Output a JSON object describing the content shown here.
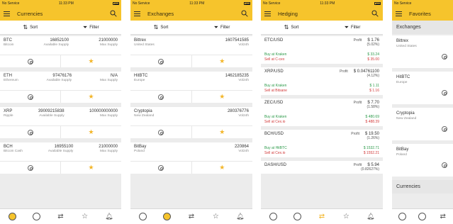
{
  "status": {
    "carrier": "No Service",
    "time": "11:33 PM"
  },
  "screens": {
    "currencies": {
      "title": "Currencies",
      "sort_label": "Sort",
      "filter_label": "Filter",
      "items": [
        {
          "symbol": "BTC",
          "name": "Bitcoin",
          "supply": "16852100",
          "supply_label": "Available Supply",
          "max": "21000000",
          "max_label": "Max Supply"
        },
        {
          "symbol": "ETH",
          "name": "Ethereum",
          "supply": "97476176",
          "supply_label": "Available Supply",
          "max": "N/A",
          "max_label": "Max Supply"
        },
        {
          "symbol": "XRP",
          "name": "Ripple",
          "supply": "39009215838",
          "supply_label": "Available Supply",
          "max": "100000000000",
          "max_label": "Max Supply"
        },
        {
          "symbol": "BCH",
          "name": "Bitcoin Cash",
          "supply": "16955100",
          "supply_label": "Available Supply",
          "max": "21000000",
          "max_label": "Max Supply"
        }
      ]
    },
    "exchanges": {
      "title": "Exchanges",
      "sort_label": "Sort",
      "filter_label": "Filter",
      "items": [
        {
          "name": "Bittrex",
          "country": "United States",
          "volume": "1607541585",
          "vol_label": "Vol24h"
        },
        {
          "name": "HitBTC",
          "country": "Europe",
          "volume": "1462185235",
          "vol_label": "Vol24h"
        },
        {
          "name": "Cryptopia",
          "country": "New Zealand",
          "volume": "280376776",
          "vol_label": "Vol24h"
        },
        {
          "name": "BitBay",
          "country": "Poland",
          "volume": "220864",
          "vol_label": "Vol24h"
        }
      ]
    },
    "hedging": {
      "title": "Hedging",
      "sort_label": "Sort",
      "filter_label": "Filter",
      "items": [
        {
          "pair": "ETC/USD",
          "profit_label": "Profit",
          "value": "$ 1.76",
          "pct": "(5.02%)",
          "buy": "Buy at Kraken",
          "buy_price": "$ 33.24",
          "sell": "Sell at C-cex",
          "sell_price": "$ 35.00"
        },
        {
          "pair": "XRP/USD",
          "profit_label": "Profit",
          "value": "$ 0.04761100",
          "pct": "(4.12%)",
          "buy": "Buy at Kraken",
          "buy_price": "$ 1.11",
          "sell": "Sell at Bitsane",
          "sell_price": "$ 1.16"
        },
        {
          "pair": "ZEC/USD",
          "profit_label": "Profit",
          "value": "$ 7.70",
          "pct": "(1.58%)",
          "buy": "Buy at Kraken",
          "buy_price": "$ 480.69",
          "sell": "Sell at Cex.io",
          "sell_price": "$ 488.39"
        },
        {
          "pair": "BCH/USD",
          "profit_label": "Profit",
          "value": "$ 19.50",
          "pct": "(1.26%)",
          "buy": "Buy at HitBTC",
          "buy_price": "$ 1532.71",
          "sell": "Sell at Cex.io",
          "sell_price": "$ 1552.21"
        },
        {
          "pair": "DASH/USD",
          "profit_label": "Profit",
          "value": "$ 5.94",
          "pct": "(0.82627%)",
          "buy": "",
          "buy_price": "",
          "sell": "",
          "sell_price": ""
        }
      ]
    },
    "favorites": {
      "title": "Favorites",
      "section_exchanges": "Exchanges",
      "section_currencies": "Currencies",
      "items": [
        {
          "name": "Bittrex",
          "country": "United States"
        },
        {
          "name": "HitBTC",
          "country": "Europe"
        },
        {
          "name": "Cryptopia",
          "country": "New Zealand"
        },
        {
          "name": "BitBay",
          "country": "Poland"
        }
      ]
    }
  },
  "colors": {
    "accent": "#f6c42c",
    "buy": "#2c9a4a",
    "sell": "#d23a3a",
    "star": "#f3b62a"
  },
  "tabs": [
    "currencies-icon",
    "exchanges-icon",
    "hedging-icon",
    "favorites-icon",
    "alerts-icon"
  ]
}
